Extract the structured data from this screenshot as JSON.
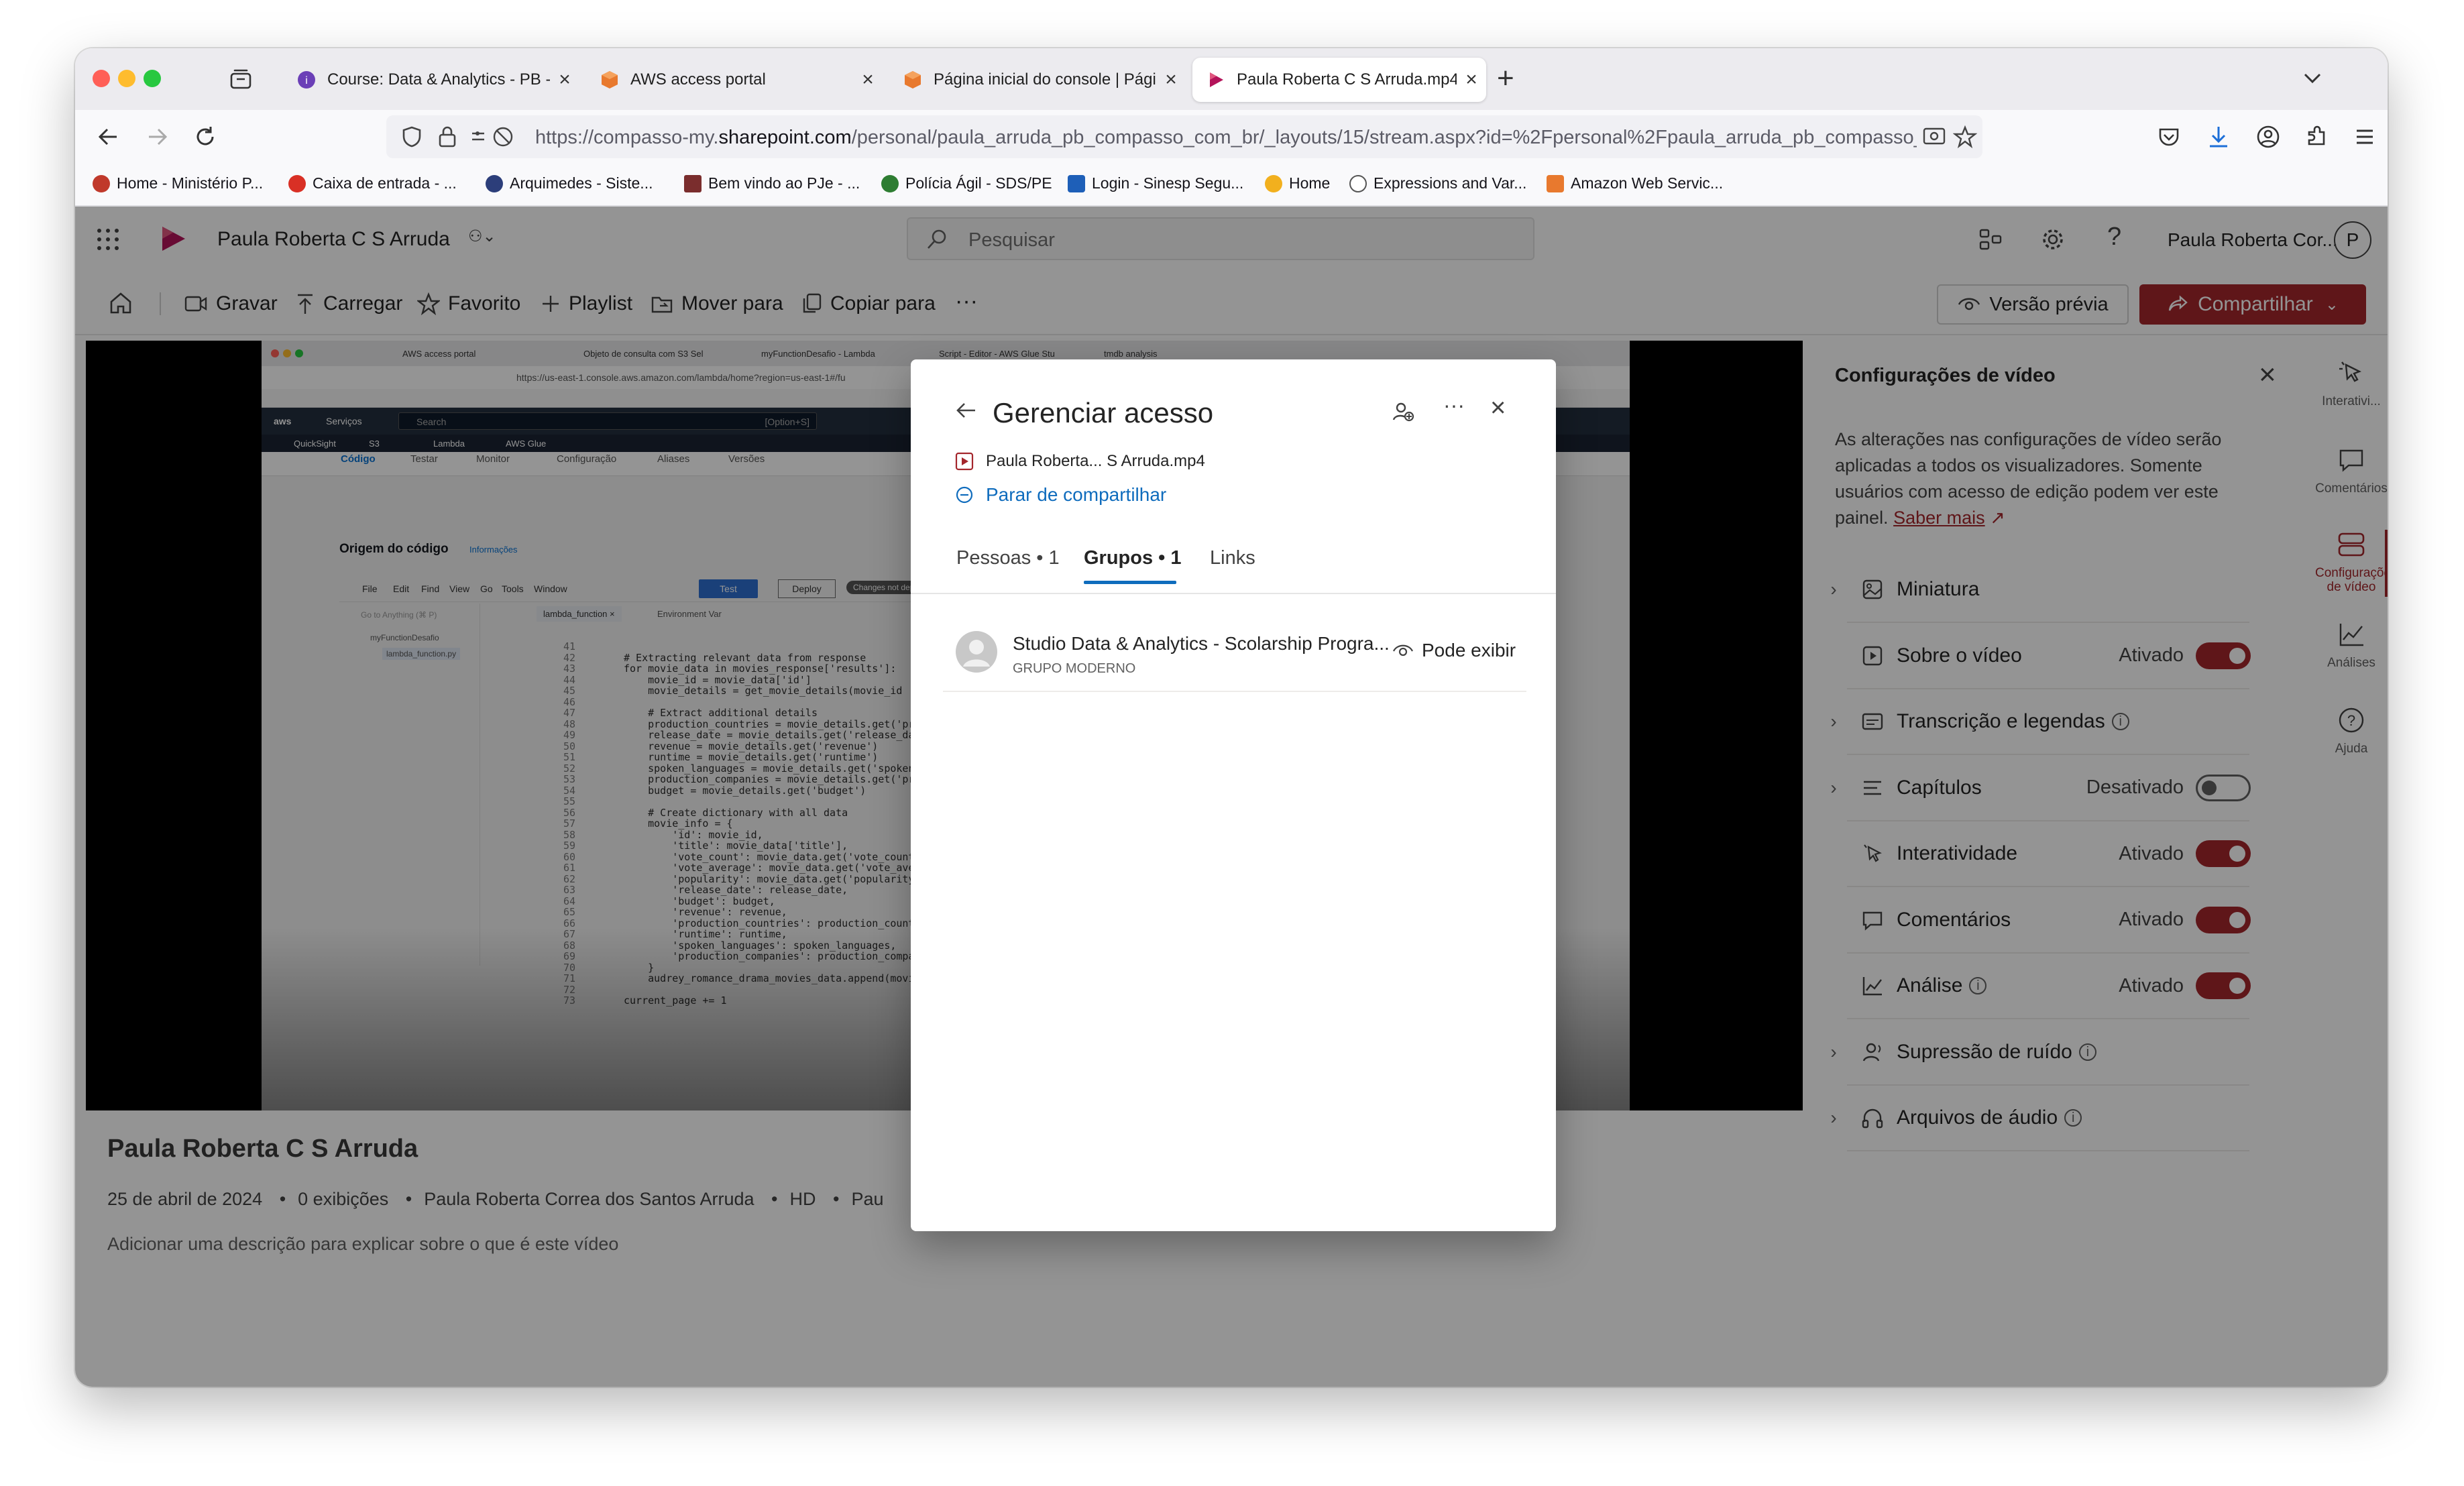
{
  "browser": {
    "tabs": [
      {
        "label": "Course: Data & Analytics - PB -",
        "icon": "course-icon",
        "color": "#6b3fb7"
      },
      {
        "label": "AWS access portal",
        "icon": "aws-cube-icon",
        "color": "#e8792e"
      },
      {
        "label": "Página inicial do console | Págir",
        "icon": "aws-cube-icon",
        "color": "#e8792e"
      },
      {
        "label": "Paula Roberta C S Arruda.mp4",
        "icon": "stream-play-icon",
        "color": "#b4145a"
      }
    ],
    "url_prefix": "https://compasso-my.",
    "url_domain": "sharepoint.com",
    "url_rest": "/personal/paula_arruda_pb_compasso_com_br/_layouts/15/stream.aspx?id=%2Fpersonal%2Fpaula_arruda_pb_compasso_",
    "bookmarks": [
      {
        "label": "Home - Ministério P...",
        "color": "#c0392b"
      },
      {
        "label": "Caixa de entrada - ...",
        "color": "#d93025"
      },
      {
        "label": "Arquimedes - Siste...",
        "color": "#2c3e7a"
      },
      {
        "label": "Bem vindo ao PJe - ...",
        "color": "#7a2d2d"
      },
      {
        "label": "Polícia Ágil - SDS/PE",
        "color": "#2e7d32"
      },
      {
        "label": "Login - Sinesp Segu...",
        "color": "#1e5fb8"
      },
      {
        "label": "Home",
        "color": "#f2b01e"
      },
      {
        "label": "Expressions and Var...",
        "color": "#555555"
      },
      {
        "label": "Amazon Web Servic...",
        "color": "#e8792e"
      }
    ]
  },
  "app": {
    "user_title": "Paula Roberta C S Arruda",
    "search_placeholder": "Pesquisar",
    "account_name": "Paula Roberta Cor...",
    "avatar_initial": "P",
    "commands": {
      "record": "Gravar",
      "upload": "Carregar",
      "favorite": "Favorito",
      "playlist": "Playlist",
      "move": "Mover para",
      "copy": "Copiar para",
      "more": "···",
      "preview": "Versão prévia",
      "share": "Compartilhar"
    }
  },
  "video": {
    "title": "Paula Roberta C S Arruda",
    "date": "25 de abril de 2024",
    "views": "0 exibições",
    "author": "Paula Roberta Correa dos Santos Arruda",
    "quality": "HD",
    "extra": "Pau",
    "description_placeholder": "Adicionar uma descrição para explicar sobre o que é este vídeo"
  },
  "embedded_screen": {
    "url": "https://us-east-1.console.aws.amazon.com/lambda/home?region=us-east-1#/fu",
    "tabs": [
      "AWS access portal",
      "Objeto de consulta com S3 Sel",
      "myFunctionDesafio - Lambda",
      "Script - Editor - AWS Glue Stu",
      "tmdb analysis"
    ],
    "services": [
      "Serviços",
      "QuickSight",
      "S3",
      "Lambda",
      "AWS Glue"
    ],
    "search": "Search",
    "shortcut": "[Option+S]",
    "subtabs": [
      "Código",
      "Testar",
      "Monitor",
      "Configuração",
      "Aliases",
      "Versões"
    ],
    "section": "Origem do código",
    "section_info": "Informações",
    "menu": [
      "File",
      "Edit",
      "Find",
      "View",
      "Go",
      "Tools",
      "Window"
    ],
    "btn_test": "Test",
    "btn_deploy": "Deploy",
    "not_deployed": "Changes not deployed",
    "goto": "Go to Anything (⌘ P)",
    "file_tab": "lambda_function ×",
    "env_tab": "Environment Var",
    "tree_folder": "myFunctionDesafio",
    "tree_file": "lambda_function.py",
    "line_numbers": "41\n42\n43\n44\n45\n46\n47\n48\n49\n50\n51\n52\n53\n54\n55\n56\n57\n58\n59\n60\n61\n62\n63\n64\n65\n66\n67\n68\n69\n70\n71\n72\n73",
    "code": "\n# Extracting relevant data from response\nfor movie_data in movies_response['results']:\n    movie_id = movie_data['id']\n    movie_details = get_movie_details(movie_id\n\n    # Extract additional details\n    production_countries = movie_details.get('pro\n    release_date = movie_details.get('release_da\n    revenue = movie_details.get('revenue')\n    runtime = movie_details.get('runtime')\n    spoken_languages = movie_details.get('spoken_l\n    production_companies = movie_details.get('prod\n    budget = movie_details.get('budget')\n\n    # Create dictionary with all data\n    movie_info = {\n        'id': movie_id,\n        'title': movie_data['title'],\n        'vote_count': movie_data.get('vote_count')\n        'vote_average': movie_data.get('vote_avera\n        'popularity': movie_data.get('popularity')\n        'release_date': release_date,\n        'budget': budget,\n        'revenue': revenue,\n        'production_countries': production_countri\n        'runtime': runtime,\n        'spoken_languages': spoken_languages,\n        'production_companies': production_compani\n    }\n    audrey_romance_drama_movies_data.append(movie_\n\ncurrent_page += 1"
  },
  "settings_panel": {
    "title": "Configurações de vídeo",
    "description": "As alterações nas configurações de vídeo serão aplicadas a todos os visualizadores. Somente usuários com acesso de edição podem ver este painel.",
    "learn_more": "Saber mais",
    "rows": [
      {
        "name": "Miniatura",
        "state": "",
        "toggle": "none",
        "chevron": true,
        "info": false,
        "icon": "image-icon"
      },
      {
        "name": "Sobre o vídeo",
        "state": "Ativado",
        "toggle": "on",
        "chevron": false,
        "info": false,
        "icon": "video-icon"
      },
      {
        "name": "Transcrição e legendas",
        "state": "",
        "toggle": "none",
        "chevron": true,
        "info": true,
        "icon": "captions-icon"
      },
      {
        "name": "Capítulos",
        "state": "Desativado",
        "toggle": "off",
        "chevron": true,
        "info": false,
        "icon": "chapters-icon"
      },
      {
        "name": "Interatividade",
        "state": "Ativado",
        "toggle": "on",
        "chevron": false,
        "info": false,
        "icon": "interactivity-icon"
      },
      {
        "name": "Comentários",
        "state": "Ativado",
        "toggle": "on",
        "chevron": false,
        "info": false,
        "icon": "comment-icon"
      },
      {
        "name": "Análise",
        "state": "Ativado",
        "toggle": "on",
        "chevron": false,
        "info": true,
        "icon": "analytics-icon"
      },
      {
        "name": "Supressão de ruído",
        "state": "",
        "toggle": "none",
        "chevron": true,
        "info": true,
        "icon": "noise-icon"
      },
      {
        "name": "Arquivos de áudio",
        "state": "",
        "toggle": "none",
        "chevron": true,
        "info": true,
        "icon": "headphones-icon"
      }
    ]
  },
  "right_rail": [
    {
      "label": "Interativi...",
      "icon": "interactivity-icon"
    },
    {
      "label": "Comentários",
      "icon": "comment-icon"
    },
    {
      "label": "Configurações de vídeo",
      "icon": "settings-panel-icon"
    },
    {
      "label": "Análises",
      "icon": "analytics-icon"
    },
    {
      "label": "Ajuda",
      "icon": "help-icon"
    }
  ],
  "dialog": {
    "title": "Gerenciar acesso",
    "file_name": "Paula Roberta... S Arruda.mp4",
    "stop_sharing": "Parar de compartilhar",
    "tabs": [
      "Pessoas • 1",
      "Grupos • 1",
      "Links"
    ],
    "active_tab": 1,
    "group_name": "Studio Data & Analytics - Scolarship Progra...",
    "group_type": "GRUPO MODERNO",
    "permission": "Pode exibir"
  },
  "colors": {
    "accent": "#a4262c",
    "link": "#0f6cbd",
    "tab_underline": "#0f6cbd"
  }
}
